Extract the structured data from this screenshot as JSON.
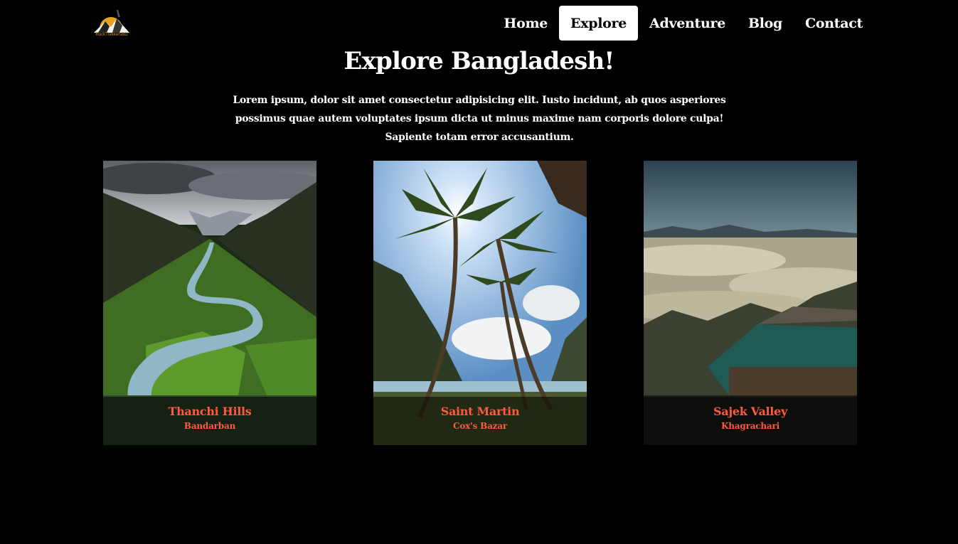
{
  "brand": {
    "logo_text": "RockTrekkersBD"
  },
  "nav": {
    "items": [
      {
        "label": "Home"
      },
      {
        "label": "Explore"
      },
      {
        "label": "Adventure"
      },
      {
        "label": "Blog"
      },
      {
        "label": "Contact"
      }
    ],
    "active": "Explore"
  },
  "hero": {
    "title": "Explore Bangladesh!",
    "text": "Lorem ipsum, dolor sit amet consectetur adipisicing elit. Iusto incidunt, ab quos asperiores possimus quae autem voluptates ipsum dicta ut minus maxime nam corporis dolore culpa! Sapiente totam error accusantium."
  },
  "cards": [
    {
      "name": "Thanchi Hills",
      "location": "Bandarban",
      "image": "river-valley"
    },
    {
      "name": "Saint Martin",
      "location": "Cox's Bazar",
      "image": "palm-beach"
    },
    {
      "name": "Sajek Valley",
      "location": "Khagrachari",
      "image": "cloud-hills"
    }
  ],
  "colors": {
    "accent": "#ff5a3c",
    "background": "#000000",
    "logo": "#d89a2a"
  }
}
